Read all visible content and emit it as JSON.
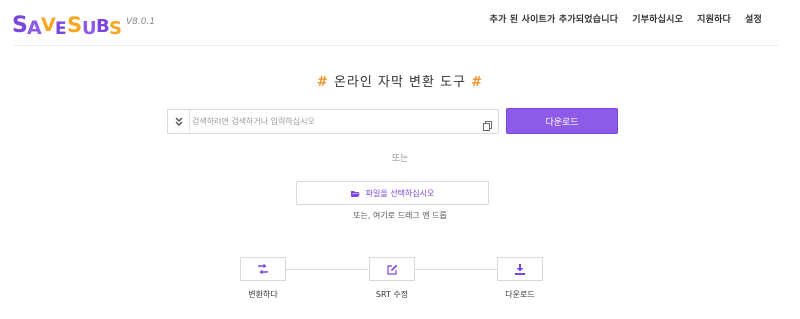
{
  "header": {
    "logo_alt": "SaveSubs",
    "version": "V8.0.1",
    "nav": [
      {
        "label": "추가 된 사이트가 추가되었습니다"
      },
      {
        "label": "기부하십시오"
      },
      {
        "label": "지원하다"
      },
      {
        "label": "설정"
      }
    ]
  },
  "main": {
    "title_hash_left": "#",
    "title": "온라인 자막 변환 도구",
    "title_hash_right": "#",
    "search": {
      "placeholder": "검색하려면 검색하거나 입력하십시오",
      "value": ""
    },
    "download_label": "다운로드",
    "or_label": "또는",
    "file_button_label": "파일을 선택하십시오",
    "drag_hint": "또는, 여기로 드래그 앤 드롭"
  },
  "steps": [
    {
      "icon": "convert-icon",
      "label": "변환하다"
    },
    {
      "icon": "edit-icon",
      "label": "SRT 수정"
    },
    {
      "icon": "download-icon",
      "label": "다운로드"
    }
  ],
  "colors": {
    "accent": "#8e5ae8",
    "hash": "#f0932b",
    "logo_purple": "#7b45df",
    "logo_orange": "#f5a623"
  }
}
